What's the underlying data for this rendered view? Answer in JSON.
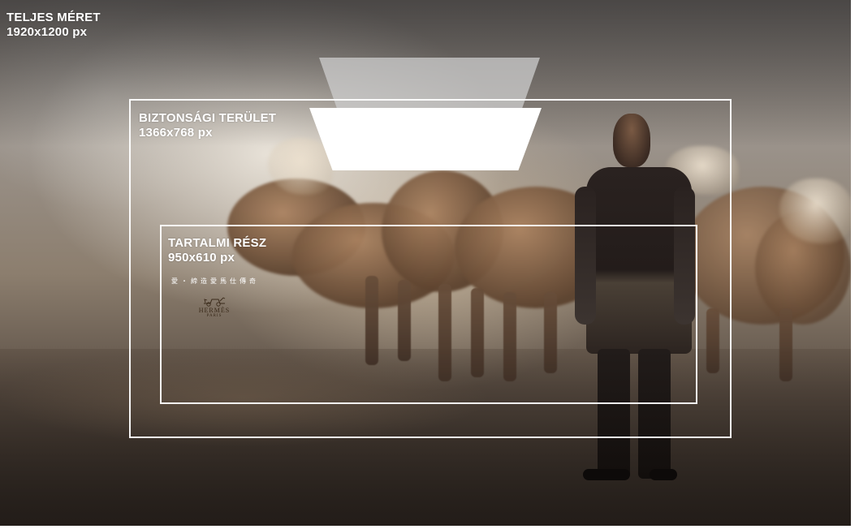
{
  "full_size": {
    "title": "TELJES MÉRET",
    "dimensions": "1920x1200 px"
  },
  "safe_area": {
    "title": "BIZTONSÁGI TERÜLET",
    "dimensions": "1366x768 px"
  },
  "content_area": {
    "title": "TARTALMI RÉSZ",
    "dimensions": "950x610 px"
  },
  "ad": {
    "tagline": "愛・締造愛馬仕傳奇",
    "brand": "HERMÈS",
    "city": "PARIS"
  },
  "colors": {
    "frame": "#ffffff",
    "label": "#ffffff",
    "trapezoid_top": "#cdcdcd",
    "trapezoid_bottom": "#ffffff"
  },
  "icons": {
    "brand_mark": "carriage-logo-icon"
  }
}
